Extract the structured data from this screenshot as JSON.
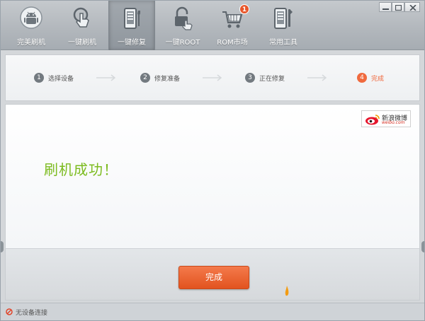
{
  "toolbar": {
    "items": [
      {
        "label": "完美刷机",
        "icon": "android-robot-icon"
      },
      {
        "label": "一键刷机",
        "icon": "tap-hand-icon"
      },
      {
        "label": "一键修复",
        "icon": "phone-wrench-icon"
      },
      {
        "label": "一键ROOT",
        "icon": "lock-hand-icon"
      },
      {
        "label": "ROM市场",
        "icon": "shopping-cart-icon",
        "badge": "1"
      },
      {
        "label": "常用工具",
        "icon": "phone-tools-icon"
      }
    ],
    "active_index": 2
  },
  "steps": [
    {
      "num": "1",
      "label": "选择设备"
    },
    {
      "num": "2",
      "label": "修复准备"
    },
    {
      "num": "3",
      "label": "正在修复"
    },
    {
      "num": "4",
      "label": "完成"
    }
  ],
  "current_step": 4,
  "content": {
    "message": "刷机成功！",
    "weibo_title": "新浪微博",
    "weibo_url": "weibo.com"
  },
  "action": {
    "done_label": "完成"
  },
  "status": {
    "text": "无设备连接"
  },
  "colors": {
    "accent": "#f06a3e",
    "success": "#7cbb1f",
    "toolbar": "#b3b8bd"
  }
}
